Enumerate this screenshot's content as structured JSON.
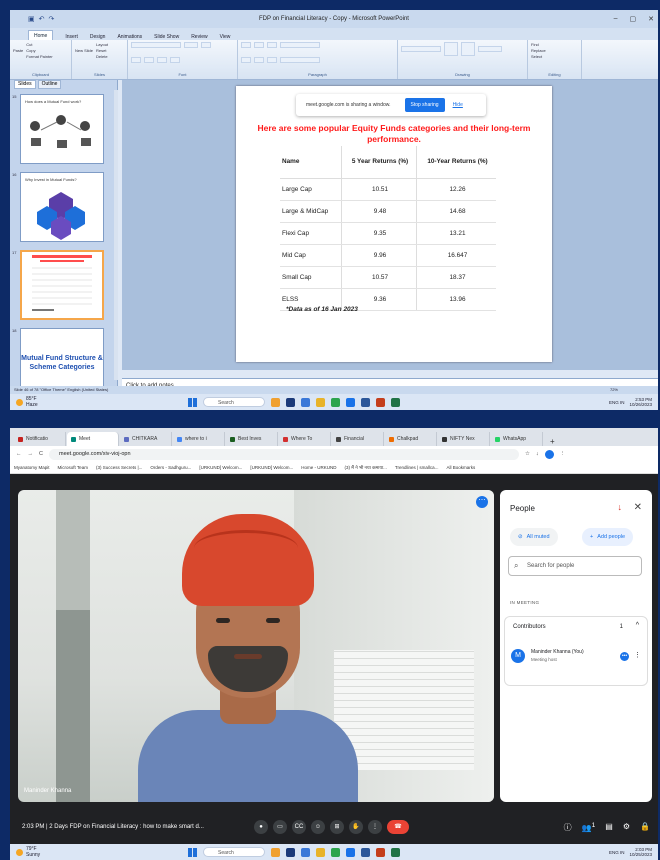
{
  "ppt": {
    "title": "FDP on Financial Literacy - Copy - Microsoft PowerPoint",
    "tabs": [
      "Home",
      "Insert",
      "Design",
      "Animations",
      "Slide Show",
      "Review",
      "View"
    ],
    "ribbon_groups": [
      "Clipboard",
      "Slides",
      "Font",
      "Paragraph",
      "Drawing",
      "Editing"
    ],
    "clipboard": {
      "paste": "Paste",
      "cut": "Cut",
      "copy": "Copy",
      "format_painter": "Format Painter"
    },
    "slides_group": {
      "new_slide": "New Slide",
      "layout": "Layout",
      "reset": "Reset",
      "delete": "Delete"
    },
    "editing": {
      "find": "Find",
      "replace": "Replace",
      "select": "Select"
    },
    "side_tabs": [
      "Slides",
      "Outline"
    ],
    "thumbs": [
      {
        "num": "15",
        "title": "How does a Mutual Fund work?"
      },
      {
        "num": "16",
        "title": "Why Invest in Mutual Funds?"
      },
      {
        "num": "17",
        "title": ""
      },
      {
        "num": "18",
        "title": "Mutual Fund Structure & Scheme Categories"
      }
    ],
    "share_bar": {
      "text": "meet.google.com is sharing a window.",
      "stop": "Stop sharing",
      "hide": "Hide"
    },
    "slide": {
      "heading": "Here are some popular Equity Funds categories and their long-term performance.",
      "columns": [
        "Name",
        "5 Year Returns (%)",
        "10-Year Returns (%)"
      ],
      "rows": [
        [
          "Large Cap",
          "10.51",
          "12.26"
        ],
        [
          "Large & MidCap",
          "9.48",
          "14.68"
        ],
        [
          "Flexi Cap",
          "9.35",
          "13.21"
        ],
        [
          "Mid Cap",
          "9.96",
          "16.647"
        ],
        [
          "Small Cap",
          "10.57",
          "18.37"
        ],
        [
          "ELSS",
          "9.36",
          "13.96"
        ]
      ],
      "footnote": "*Data as of 16 Jan 2023"
    },
    "notes_placeholder": "Click to add notes",
    "status": "Slide 46 of 78   \"Office Theme\"   English (United States)",
    "zoom": "72%"
  },
  "taskbar_top": {
    "temp": "85°F",
    "weather": "Haze",
    "search": "Search",
    "time": "2:53 PM",
    "date": "10/26/2023",
    "lang": "ENG IN"
  },
  "chrome": {
    "tabs": [
      "Notificatio",
      "Meet",
      "CHITKARA",
      "where to i",
      "Best Inves",
      "Where To",
      "Financial",
      "Chalkpad",
      "NIFTY Nex",
      "WhatsApp"
    ],
    "url": "meet.google.com/xiv-vioj-opn",
    "bookmarks": [
      "Myanatomy Mapit",
      "Microsoft Team",
      "(3) Success Secrets |...",
      "Orders - Sadhguru...",
      "[URKUND] Welcom...",
      "[URKUND] Welcom...",
      "Home - URKUND",
      "(3) मैं ने भी नया कमाया...",
      "Trendlines | smallca...",
      "All Bookmarks"
    ]
  },
  "meet": {
    "video_name": "Maninder Khanna",
    "people_title": "People",
    "all_muted": "All muted",
    "add_people": "Add people",
    "search_placeholder": "Search for people",
    "in_meeting": "IN MEETING",
    "contributors": "Contributors",
    "contributors_count": "1",
    "participant_name": "Maninder Khanna (You)",
    "participant_role": "Meeting host",
    "avatar_letter": "M",
    "bottom_info": "2:03 PM  |  2 Days FDP on Financial Literacy : how to make smart d...",
    "people_count": "1"
  },
  "taskbar_bottom": {
    "temp": "79°F",
    "weather": "Sunny",
    "search": "Search",
    "time": "2:03 PM",
    "date": "10/25/2023",
    "lang": "ENG IN"
  }
}
